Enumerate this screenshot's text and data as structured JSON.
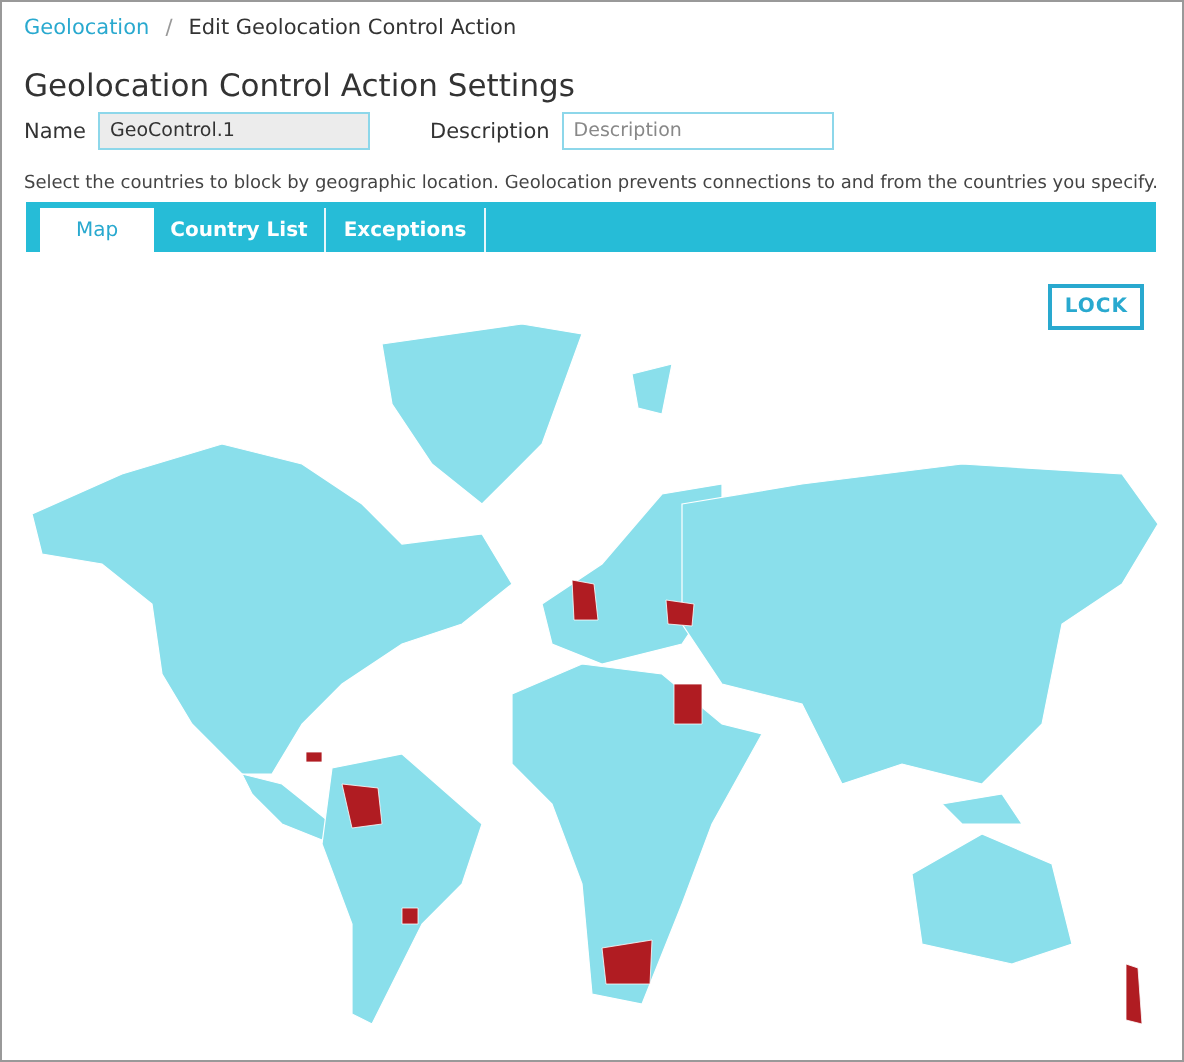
{
  "breadcrumb": [
    {
      "label": "Geolocation",
      "link": true
    },
    {
      "label": "/",
      "link": false
    },
    {
      "label": "Edit Geolocation Control Action",
      "link": false
    }
  ],
  "title": "Geolocation Control Action Settings",
  "fields": [
    {
      "label": "Name",
      "value": "GeoControl.1",
      "disabled": true
    },
    {
      "label": "Description",
      "placeholder": "Description",
      "disabled": false
    }
  ],
  "instructions": "Select the countries to block by geographic location. Geolocation prevents connections to and from the countries you specify.",
  "tabs": [
    {
      "label": "Map",
      "selected": true
    },
    {
      "label": "Country List",
      "selected": false
    },
    {
      "label": "Exceptions",
      "selected": false
    }
  ],
  "lock_button": "LOCK"
}
